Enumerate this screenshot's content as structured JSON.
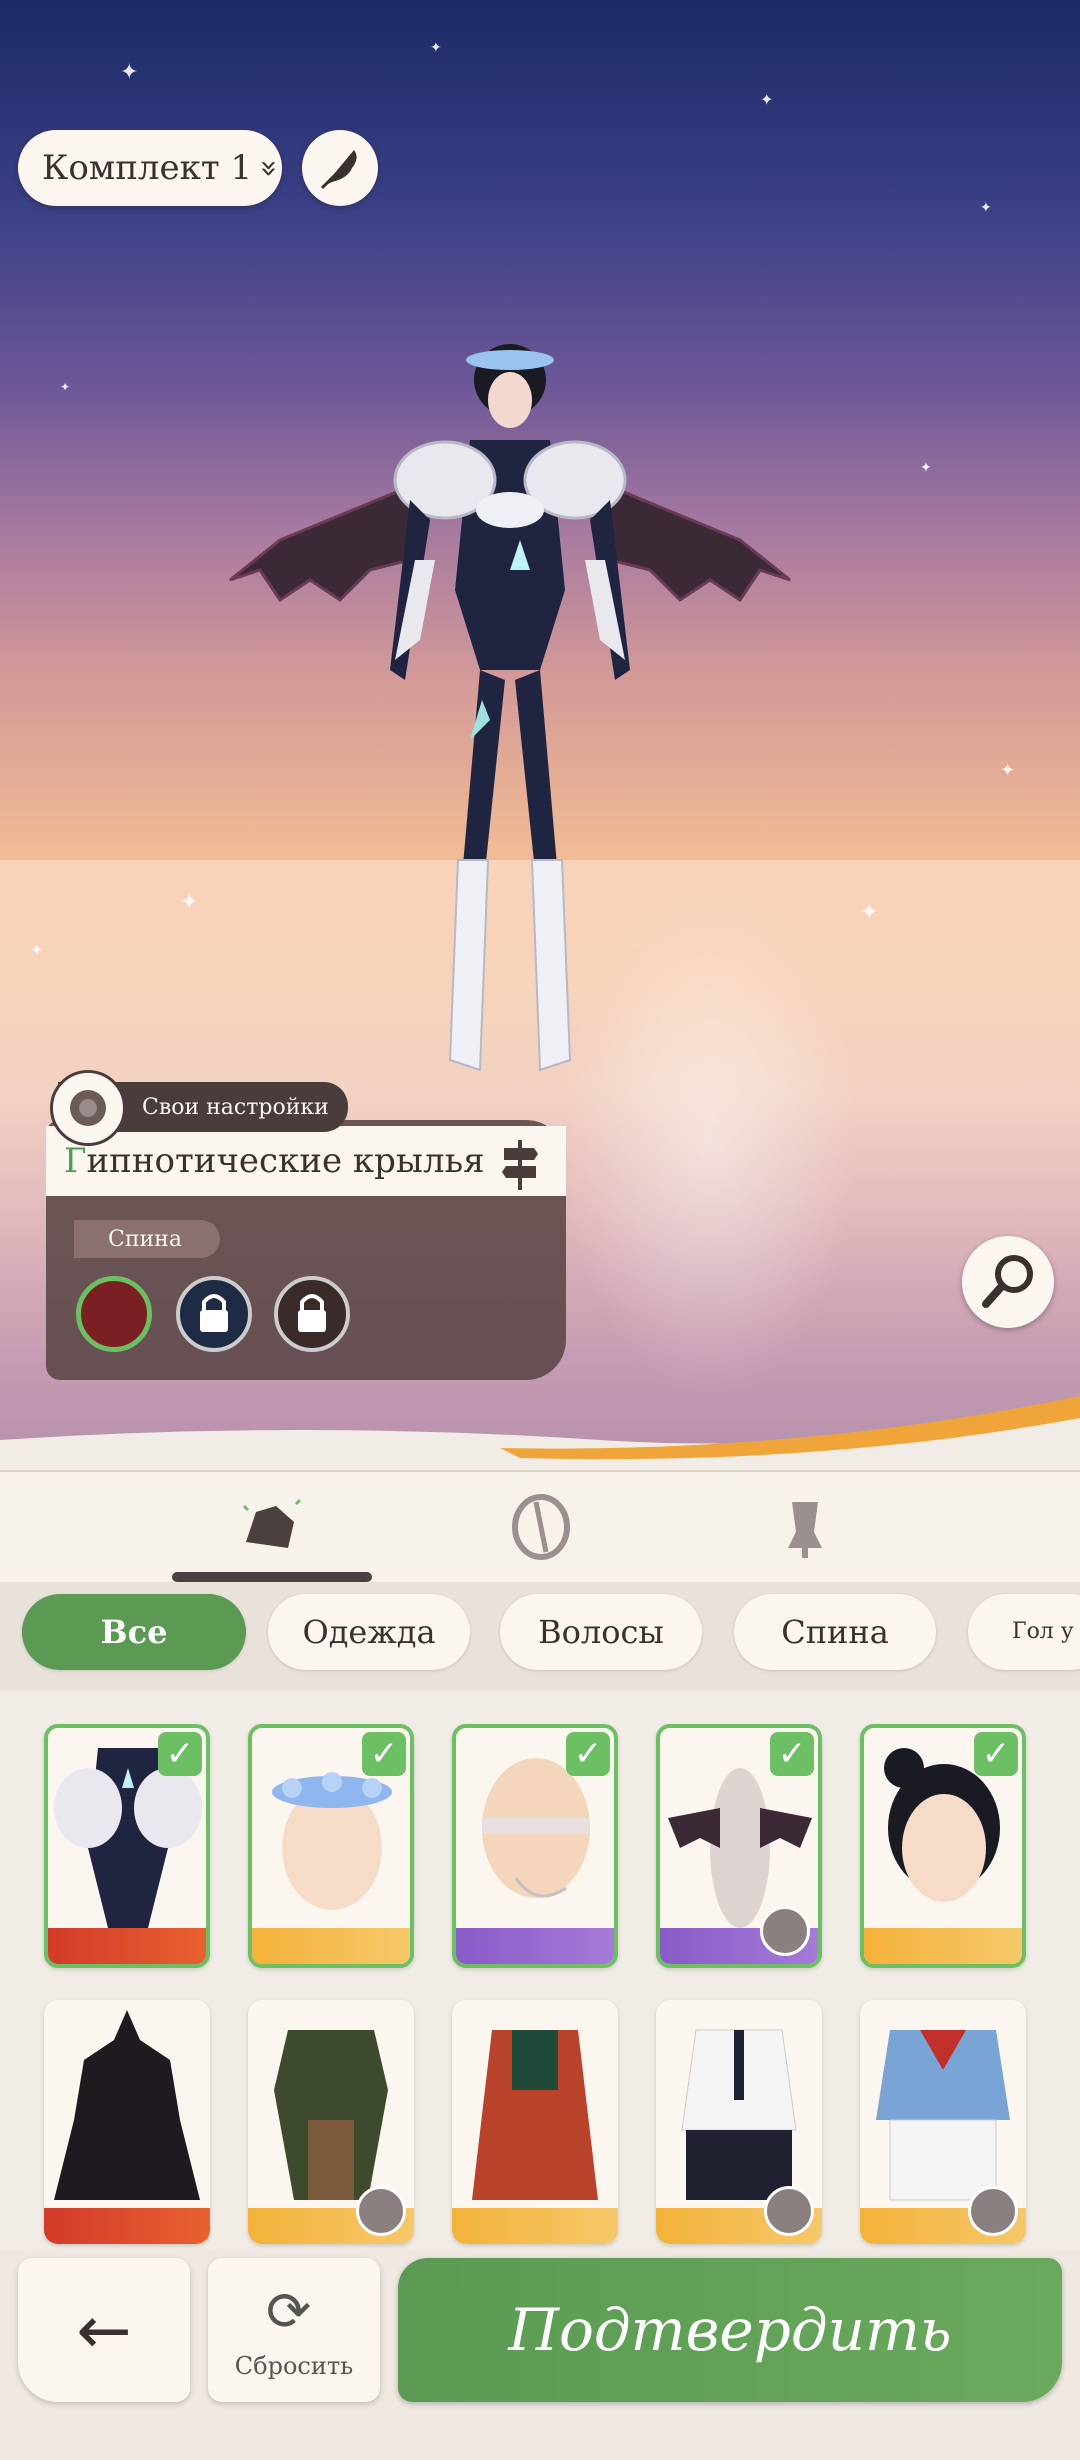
{
  "outfit_set": {
    "label": "Комплект 1",
    "chevron": "»"
  },
  "item_panel": {
    "custom_tag": "Свои настройки",
    "title_first_letter": "Г",
    "title_rest": "ипнотические крылья",
    "slot_tag": "Спина"
  },
  "filters": [
    "Все",
    "Одежда",
    "Волосы",
    "Спина",
    "Гол у"
  ],
  "bottom": {
    "reset_label": "Сбросить",
    "confirm_label": "Подтвердить",
    "back_icon": "←",
    "reset_icon": "⟳"
  },
  "grid_selected": [
    "armor-bodysuit",
    "flower-crown",
    "blindfold-chain",
    "bat-wings",
    "black-bun-hair"
  ],
  "grid_unselected": [
    "black-gown",
    "plaid-dress",
    "red-robe",
    "officer-uniform",
    "sailor-uniform"
  ],
  "check_icon": "✓"
}
